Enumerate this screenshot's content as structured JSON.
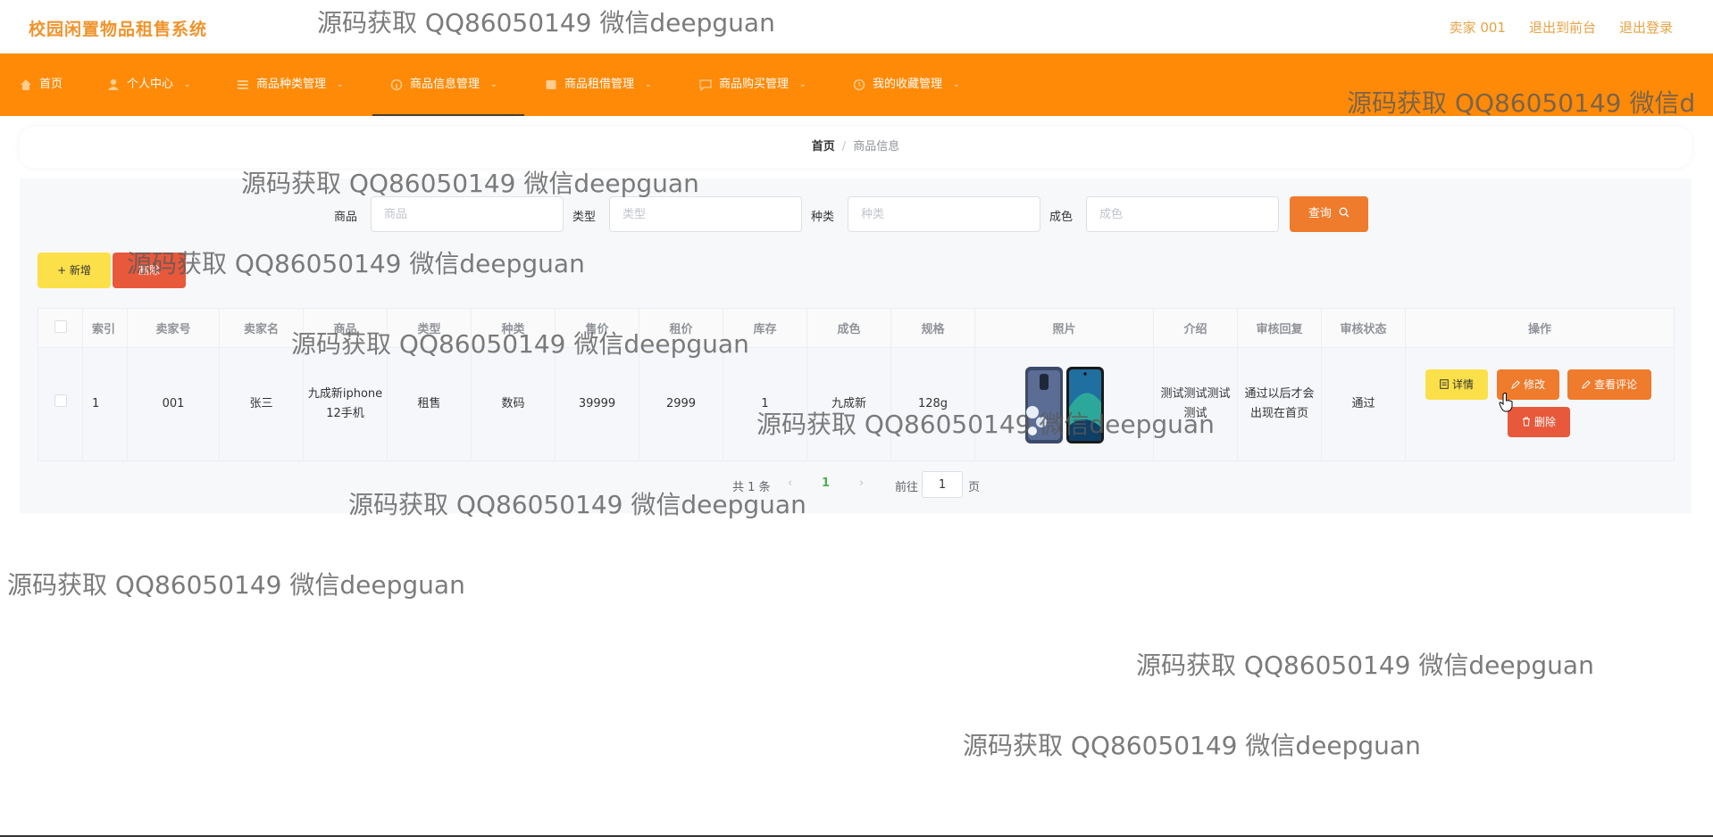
{
  "header": {
    "logo": "校园闲置物品租售系统",
    "seller": "卖家 001",
    "to_front": "退出到前台",
    "logout": "退出登录"
  },
  "nav": {
    "items": [
      {
        "label": "首页",
        "icon": "home-icon"
      },
      {
        "label": "个人中心",
        "icon": "user-icon"
      },
      {
        "label": "商品种类管理",
        "icon": "list-icon"
      },
      {
        "label": "商品信息管理",
        "icon": "info-icon",
        "active": true
      },
      {
        "label": "商品租借管理",
        "icon": "box-icon"
      },
      {
        "label": "商品购买管理",
        "icon": "chat-icon"
      },
      {
        "label": "我的收藏管理",
        "icon": "clock-icon"
      }
    ]
  },
  "breadcrumb": {
    "home": "首页",
    "separator": "/",
    "current": "商品信息"
  },
  "search": {
    "product_label": "商品",
    "product_placeholder": "商品",
    "type_label": "类型",
    "type_placeholder": "类型",
    "category_label": "种类",
    "category_placeholder": "种类",
    "condition_label": "成色",
    "condition_placeholder": "成色",
    "query_button": "查询"
  },
  "actions": {
    "add": "+ 新增",
    "delete": "删除"
  },
  "table": {
    "headers": [
      "索引",
      "卖家号",
      "卖家名",
      "商品",
      "类型",
      "种类",
      "售价",
      "租价",
      "库存",
      "成色",
      "规格",
      "照片",
      "介绍",
      "审核回复",
      "审核状态",
      "操作"
    ],
    "rows": [
      {
        "index": "1",
        "seller_no": "001",
        "seller_name": "张三",
        "product": "九成新iphone12手机",
        "type": "租售",
        "category": "数码",
        "price": "39999",
        "rent": "2999",
        "stock": "1",
        "condition": "九成新",
        "spec": "128g",
        "intro": "测试测试测试测试",
        "review_reply": "通过以后才会出现在首页",
        "review_status": "通过"
      }
    ],
    "row_actions": {
      "detail": "详情",
      "edit": "修改",
      "review": "查看评论",
      "delete": "删除"
    }
  },
  "pagination": {
    "total": "共 1 条",
    "current_page": "1",
    "goto_label": "前往",
    "goto_value": "1",
    "page_unit": "页"
  },
  "watermark": "源码获取 QQ86050149 微信deepguan",
  "watermark_cut": "源码获取 QQ86050149 微信d",
  "colors": {
    "nav": "#ff8a08",
    "accent": "#ef7b2c",
    "warning": "#fbe04a",
    "danger": "#e8583b",
    "logo": "#f0932b"
  }
}
